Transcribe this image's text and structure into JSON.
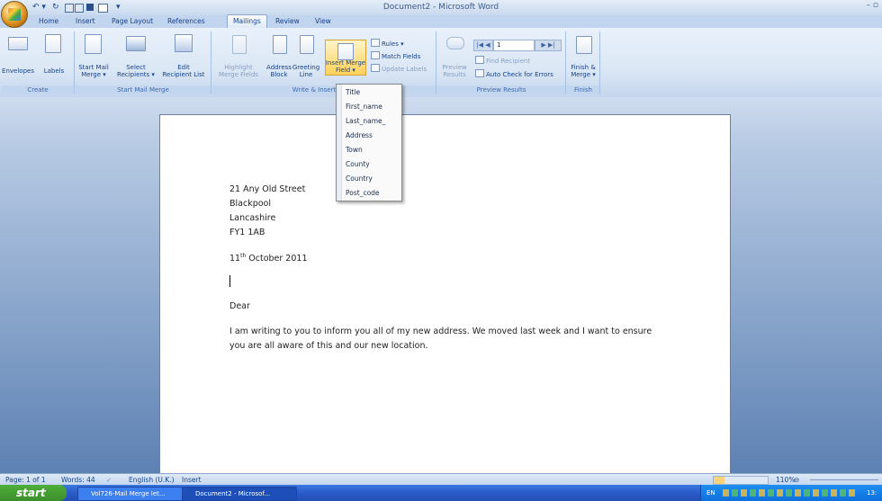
{
  "window": {
    "title": "Document2 - Microsoft Word",
    "controls": "– ▫"
  },
  "qat": {
    "undo": "↶ ▾",
    "repeat": "↻",
    "extra": "▾"
  },
  "tabs": [
    "Home",
    "Insert",
    "Page Layout",
    "References",
    "Mailings",
    "Review",
    "View"
  ],
  "ribbon": {
    "groups": {
      "create": "Create",
      "start": "Start Mail Merge",
      "write": "Write & Insert Fields",
      "preview": "Preview Results",
      "finish": "Finish"
    },
    "envelopes": "Envelopes",
    "labels": "Labels",
    "start_mail_merge": [
      "Start Mail",
      "Merge ▾"
    ],
    "select_recipients": [
      "Select",
      "Recipients ▾"
    ],
    "edit_recipient_list": [
      "Edit",
      "Recipient List"
    ],
    "highlight_merge_fields": [
      "Highlight",
      "Merge Fields"
    ],
    "address_block": [
      "Address",
      "Block"
    ],
    "greeting_line": [
      "Greeting",
      "Line"
    ],
    "insert_merge_field": [
      "Insert Merge",
      "Field ▾"
    ],
    "rules": "Rules ▾",
    "match_fields": "Match Fields",
    "update_labels": "Update Labels",
    "preview_results": [
      "Preview",
      "Results"
    ],
    "record_number": "1",
    "find_recipient": "Find Recipient",
    "auto_check": "Auto Check for Errors",
    "finish_merge": [
      "Finish &",
      "Merge ▾"
    ]
  },
  "merge_fields": [
    "Title",
    "First_name",
    "Last_name_",
    "Address",
    "Town",
    "County",
    "Country",
    "Post_code"
  ],
  "document": {
    "address": [
      "21 Any Old Street",
      "Blackpool",
      "Lancashire",
      "FY1 1AB"
    ],
    "date_day": "11",
    "date_sup": "th",
    "date_rest": " October 2011",
    "salutation": "Dear",
    "body": [
      "I am writing to you to inform you all of my new address.  We moved last week and I want to ensure",
      "you are all aware of this and our new location."
    ]
  },
  "status": {
    "page": "Page: 1 of 1",
    "words": "Words: 44",
    "language": "English (U.K.)",
    "mode": "Insert",
    "zoom": "110%"
  },
  "taskbar": {
    "start": "start",
    "tasks": [
      "Vol726-Mail Merge let...",
      "Document2 - Microsof..."
    ],
    "lang": "EN",
    "time": "13:"
  }
}
